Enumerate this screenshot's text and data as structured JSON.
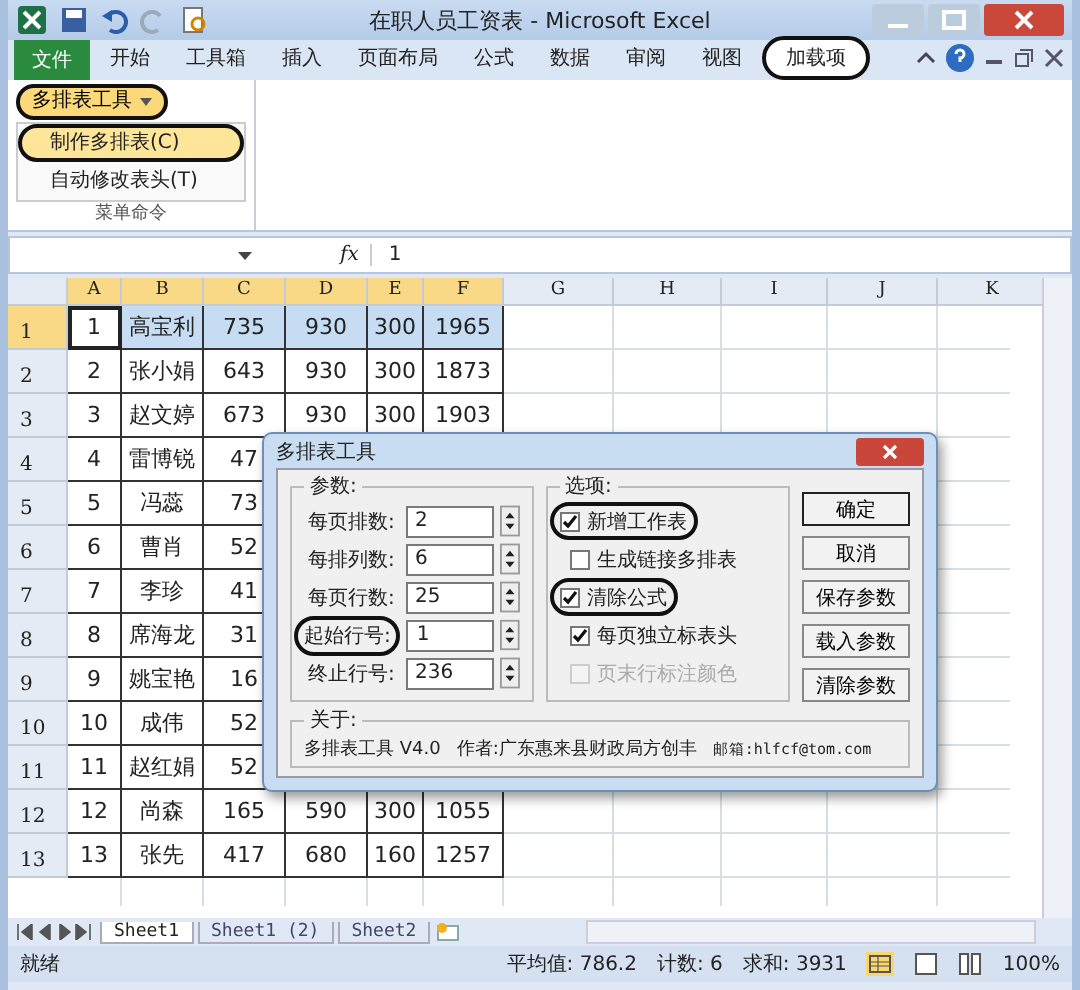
{
  "window": {
    "title": "在职人员工资表 - Microsoft Excel"
  },
  "ribbon_tabs": [
    {
      "label": "文件",
      "kind": "file",
      "selected": false,
      "circled": false
    },
    {
      "label": "开始",
      "kind": "tab",
      "selected": false,
      "circled": false
    },
    {
      "label": "工具箱",
      "kind": "tab",
      "selected": false,
      "circled": false
    },
    {
      "label": "插入",
      "kind": "tab",
      "selected": false,
      "circled": false
    },
    {
      "label": "页面布局",
      "kind": "tab",
      "selected": false,
      "circled": false
    },
    {
      "label": "公式",
      "kind": "tab",
      "selected": false,
      "circled": false
    },
    {
      "label": "数据",
      "kind": "tab",
      "selected": false,
      "circled": false
    },
    {
      "label": "审阅",
      "kind": "tab",
      "selected": false,
      "circled": false
    },
    {
      "label": "视图",
      "kind": "tab",
      "selected": false,
      "circled": false
    },
    {
      "label": "加载项",
      "kind": "tab",
      "selected": true,
      "circled": true
    }
  ],
  "ribbon": {
    "menu_button": {
      "label": "多排表工具",
      "circled": true
    },
    "menu_items": [
      {
        "label": "制作多排表(C)",
        "selected": true,
        "circled": true
      },
      {
        "label": "自动修改表头(T)",
        "selected": false,
        "circled": false
      }
    ],
    "group_label": "菜单命令"
  },
  "formula_bar": {
    "function_label": "fx",
    "value": "1"
  },
  "columns": [
    {
      "label": "A",
      "selected": true
    },
    {
      "label": "B",
      "selected": true
    },
    {
      "label": "C",
      "selected": true
    },
    {
      "label": "D",
      "selected": true
    },
    {
      "label": "E",
      "selected": true
    },
    {
      "label": "F",
      "selected": true
    },
    {
      "label": "G",
      "selected": false
    },
    {
      "label": "H",
      "selected": false
    },
    {
      "label": "I",
      "selected": false
    },
    {
      "label": "J",
      "selected": false
    },
    {
      "label": "K",
      "selected": false
    }
  ],
  "rows": [
    {
      "header": "1",
      "selected": true,
      "cells": [
        "1",
        "高宝利",
        "735",
        "930",
        "300",
        "1965"
      ]
    },
    {
      "header": "2",
      "selected": false,
      "cells": [
        "2",
        "张小娟",
        "643",
        "930",
        "300",
        "1873"
      ]
    },
    {
      "header": "3",
      "selected": false,
      "cells": [
        "3",
        "赵文婷",
        "673",
        "930",
        "300",
        "1903"
      ]
    },
    {
      "header": "4",
      "selected": false,
      "cells": [
        "4",
        "雷博锐",
        "47"
      ]
    },
    {
      "header": "5",
      "selected": false,
      "cells": [
        "5",
        "冯蕊",
        "73"
      ]
    },
    {
      "header": "6",
      "selected": false,
      "cells": [
        "6",
        "曹肖",
        "52"
      ]
    },
    {
      "header": "7",
      "selected": false,
      "cells": [
        "7",
        "李珍",
        "41"
      ]
    },
    {
      "header": "8",
      "selected": false,
      "cells": [
        "8",
        "席海龙",
        "31"
      ]
    },
    {
      "header": "9",
      "selected": false,
      "cells": [
        "9",
        "姚宝艳",
        "16"
      ]
    },
    {
      "header": "10",
      "selected": false,
      "cells": [
        "10",
        "成伟",
        "52"
      ]
    },
    {
      "header": "11",
      "selected": false,
      "cells": [
        "11",
        "赵红娟",
        "52"
      ]
    },
    {
      "header": "12",
      "selected": false,
      "cells": [
        "12",
        "尚森",
        "165",
        "590",
        "300",
        "1055"
      ]
    },
    {
      "header": "13",
      "selected": false,
      "cells": [
        "13",
        "张先",
        "417",
        "680",
        "160",
        "1257"
      ]
    }
  ],
  "sheet_tabs": [
    {
      "label": "Sheet1",
      "selected": true
    },
    {
      "label": "Sheet1 (2)",
      "selected": false
    },
    {
      "label": "Sheet2",
      "selected": false
    }
  ],
  "status_bar": {
    "mode": "就绪",
    "average": "平均值: 786.2",
    "count": "计数: 6",
    "sum": "求和: 3931",
    "zoom": "100%"
  },
  "dialog": {
    "title": "多排表工具",
    "params_label": "参数:",
    "params": [
      {
        "label": "每页排数:",
        "value": "2",
        "circled": false
      },
      {
        "label": "每排列数:",
        "value": "6",
        "circled": false
      },
      {
        "label": "每页行数:",
        "value": "25",
        "circled": false
      },
      {
        "label": "起始行号:",
        "value": "1",
        "circled": true
      },
      {
        "label": "终止行号:",
        "value": "236",
        "circled": false
      }
    ],
    "options_label": "选项:",
    "options": [
      {
        "label": "新增工作表",
        "checked": true,
        "disabled": false,
        "circled": true
      },
      {
        "label": "生成链接多排表",
        "checked": false,
        "disabled": false,
        "circled": false
      },
      {
        "label": "清除公式",
        "checked": true,
        "disabled": false,
        "circled": true
      },
      {
        "label": "每页独立标表头",
        "checked": true,
        "disabled": false,
        "circled": false
      },
      {
        "label": "页末行标注颜色",
        "checked": false,
        "disabled": true,
        "circled": false
      }
    ],
    "buttons": [
      "确定",
      "取消",
      "保存参数",
      "载入参数",
      "清除参数"
    ],
    "about_label": "关于:",
    "about": [
      "多排表工具 V4.0",
      "作者:广东惠来县财政局方创丰",
      "邮箱:hlfcf@tom.com"
    ]
  }
}
